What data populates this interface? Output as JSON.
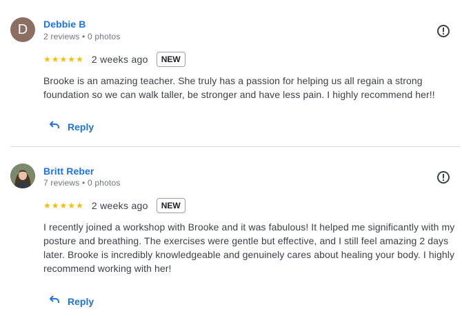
{
  "reviews": [
    {
      "avatar_letter": "D",
      "name": "Debbie B",
      "meta": "2 reviews • 0 photos",
      "rating": 5,
      "when": "2 weeks ago",
      "badge": "NEW",
      "text": "Brooke is an amazing teacher. She truly has a passion for helping us all regain a strong foundation so we can walk taller, be stronger and have less pain. I highly recommend her!!",
      "reply_label": "Reply"
    },
    {
      "name": "Britt Reber",
      "meta": "7 reviews • 0 photos",
      "rating": 5,
      "when": "2 weeks ago",
      "badge": "NEW",
      "text": "I recently joined a workshop with Brooke and it was fabulous! It helped me significantly with my posture and breathing. The exercises were gentle but effective, and I still feel amazing 2 days later. Brooke is incredibly knowledgeable and genuinely cares about healing your body. I highly recommend working with her!",
      "reply_label": "Reply"
    }
  ],
  "icons": {
    "star": "star-icon",
    "report": "report-icon",
    "reply": "reply-arrow-icon"
  },
  "colors": {
    "link": "#1a73e8",
    "star": "#fbbc04",
    "avatar_bg": "#8d6e63"
  }
}
